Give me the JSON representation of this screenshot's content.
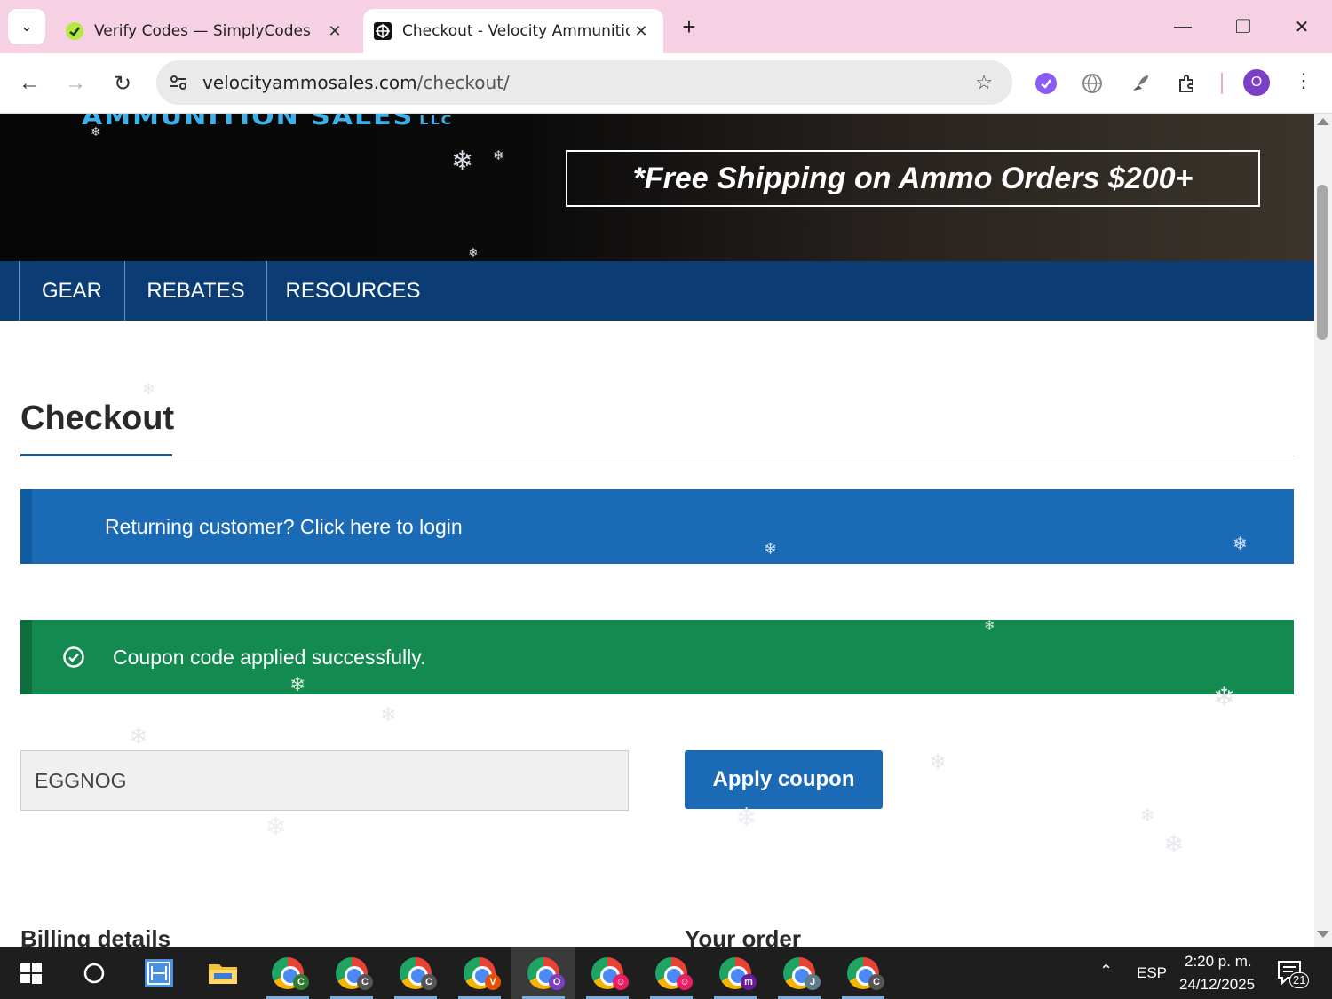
{
  "browser": {
    "tabs": [
      {
        "title": "Verify Codes — SimplyCodes",
        "icon": "simplycodes-icon"
      },
      {
        "title": "Checkout - Velocity Ammunition Sales",
        "icon": "velocity-logo-icon"
      }
    ],
    "url": {
      "host": "velocityammosales.com",
      "path": "/checkout/"
    },
    "profile_initial": "O"
  },
  "site": {
    "logo_text": "AMMUNITION SALES",
    "logo_suffix": "LLC",
    "shipping_banner": "*Free Shipping on Ammo Orders $200+",
    "nav": [
      "GEAR",
      "REBATES",
      "RESOURCES"
    ]
  },
  "checkout": {
    "title": "Checkout",
    "returning_customer": "Returning customer? Click here to login",
    "coupon_success": "Coupon code applied successfully.",
    "coupon_value": "EGGNOG",
    "apply_label": "Apply coupon",
    "billing_heading": "Billing details",
    "order_heading": "Your order"
  },
  "taskbar": {
    "chrome_badges": [
      {
        "letter": "C",
        "color": "#2e7d32"
      },
      {
        "letter": "C",
        "color": "#555555"
      },
      {
        "letter": "C",
        "color": "#555555"
      },
      {
        "letter": "V",
        "color": "#e65100"
      },
      {
        "letter": "O",
        "color": "#7b3fc5"
      },
      {
        "letter": "",
        "color": "#e91e63"
      },
      {
        "letter": "",
        "color": "#e91e63"
      },
      {
        "letter": "m",
        "color": "#6a1b9a"
      },
      {
        "letter": "J",
        "color": "#607d8b"
      },
      {
        "letter": "C",
        "color": "#555555"
      }
    ],
    "language": "ESP",
    "time": "2:20 p. m.",
    "date": "24/12/2025",
    "notifications": "21"
  },
  "colors": {
    "nav_blue": "#0c3c74",
    "info_blue": "#1b6ab5",
    "success_green": "#138a4f",
    "tab_strip": "#f6d1e4"
  }
}
